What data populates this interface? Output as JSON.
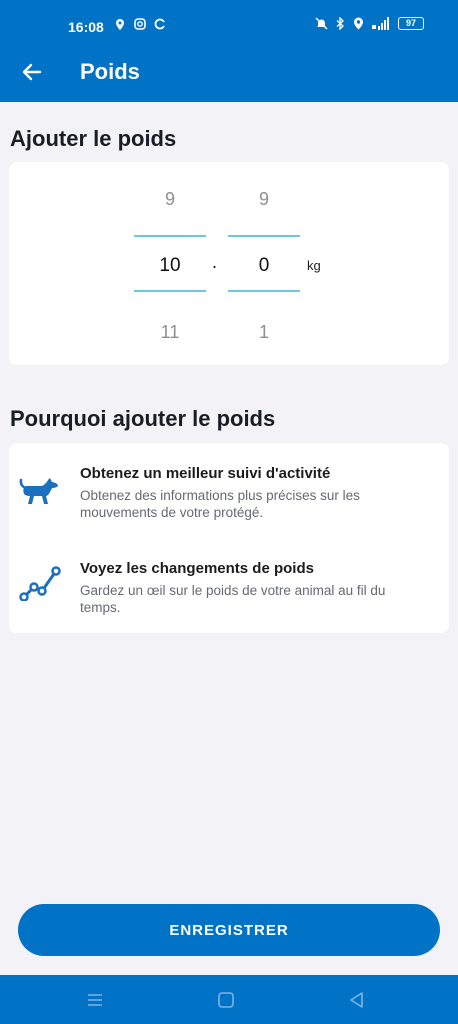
{
  "status_bar": {
    "time": "16:08",
    "battery": "97",
    "left_icons": [
      "location-pin-icon",
      "instagram-icon",
      "sync-icon"
    ],
    "right_icons": [
      "mute-icon",
      "bluetooth-icon",
      "location-icon",
      "signal-icon",
      "battery-icon"
    ]
  },
  "header": {
    "title": "Poids",
    "back_icon": "arrow-left-icon",
    "color": "#0173c7"
  },
  "add_weight": {
    "title": "Ajouter le poids",
    "integer_picker": {
      "above": "9",
      "selected": "10",
      "below": "11"
    },
    "separator": ".",
    "decimal_picker": {
      "above": "9",
      "selected": "0",
      "below": "1"
    },
    "unit": "kg"
  },
  "why": {
    "title": "Pourquoi ajouter le poids",
    "items": [
      {
        "icon": "running-dog-icon",
        "title": "Obtenez un meilleur suivi d'activité",
        "description": "Obtenez des informations plus précises sur les mouvements de votre protégé."
      },
      {
        "icon": "line-chart-icon",
        "title": "Voyez les changements de poids",
        "description": "Gardez un œil sur le poids de votre animal au fil du temps."
      }
    ]
  },
  "save_button": {
    "label": "ENREGISTRER"
  },
  "nav_bar": {
    "icons": [
      "menu-icon",
      "home-square-icon",
      "back-triangle-icon"
    ]
  }
}
